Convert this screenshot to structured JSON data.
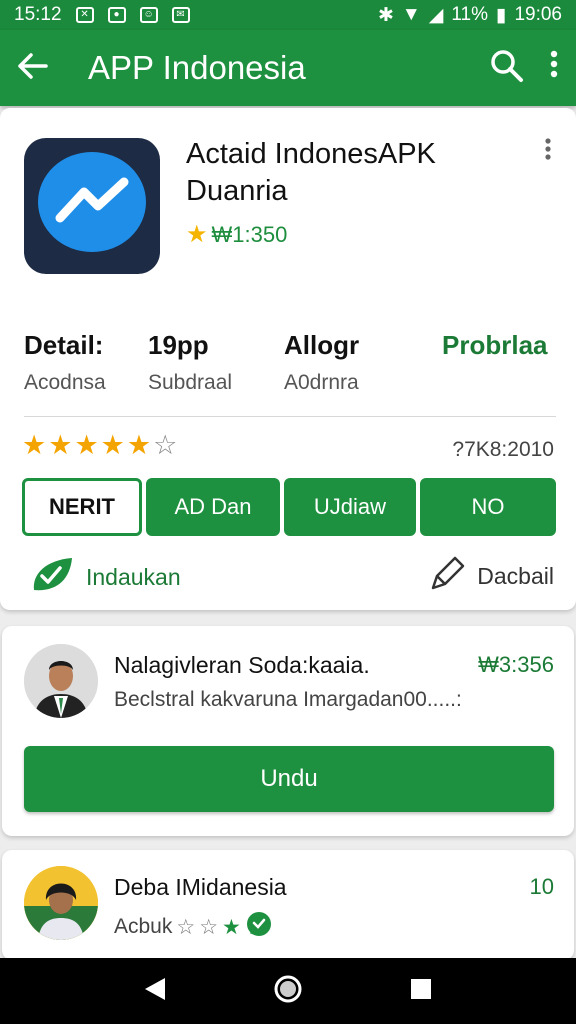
{
  "status_bar": {
    "time_left": "15:12",
    "battery": "11%",
    "time_right": "19:06"
  },
  "app_bar": {
    "title": "APP Indonesia"
  },
  "app": {
    "name": "Actaid IndonesAPK Duanria",
    "rating_text": "₩1:350",
    "stats": [
      {
        "value": "Detail:",
        "label": "Acodnsa"
      },
      {
        "value": "19pp",
        "label": "Subdraal"
      },
      {
        "value": "Allogr",
        "label": "A0drnra"
      },
      {
        "value": "Probrlaa",
        "label": ""
      }
    ],
    "star_rating": 5,
    "star_max": 6,
    "rating_count": "?7K8:2010",
    "buttons": [
      "NERIT",
      "AD Dan",
      "UJdiaw",
      "NO"
    ],
    "link_left": "Indaukan",
    "link_right": "Dacbail"
  },
  "reviews": [
    {
      "name": "Nalagivleran Soda:kaaia.",
      "subtitle": "Beclstral kakvaruna Imargadan00.....:",
      "price": "₩3:356",
      "button": "Undu"
    },
    {
      "name": "Deba IMidanesia",
      "subtitle": "Acbuk",
      "price": "10"
    }
  ],
  "colors": {
    "primary": "#1e9140",
    "status_bar": "#1b8a3c",
    "star": "#f4a400"
  }
}
